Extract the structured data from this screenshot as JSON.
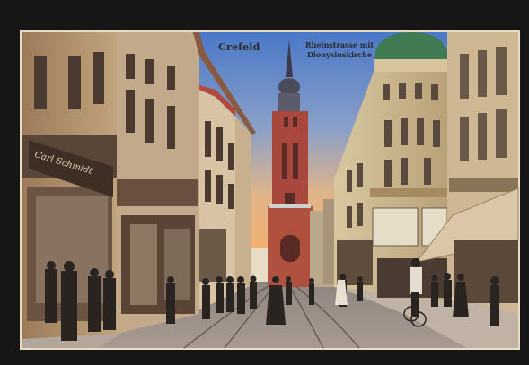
{
  "postcard": {
    "caption_town": "Crefeld",
    "caption_street_line1": "Rheinstrasse mit",
    "caption_street_line2": "Dionysiuskirche",
    "shop_sign_left": "Carl Schmidt"
  },
  "palette": {
    "frame": "#161616",
    "sky_top": "#4a78c8",
    "sky_horizon": "#f0b070",
    "church_brick": "#a8483c",
    "dome_green": "#3f7a52",
    "pavement": "#9c8f86"
  }
}
